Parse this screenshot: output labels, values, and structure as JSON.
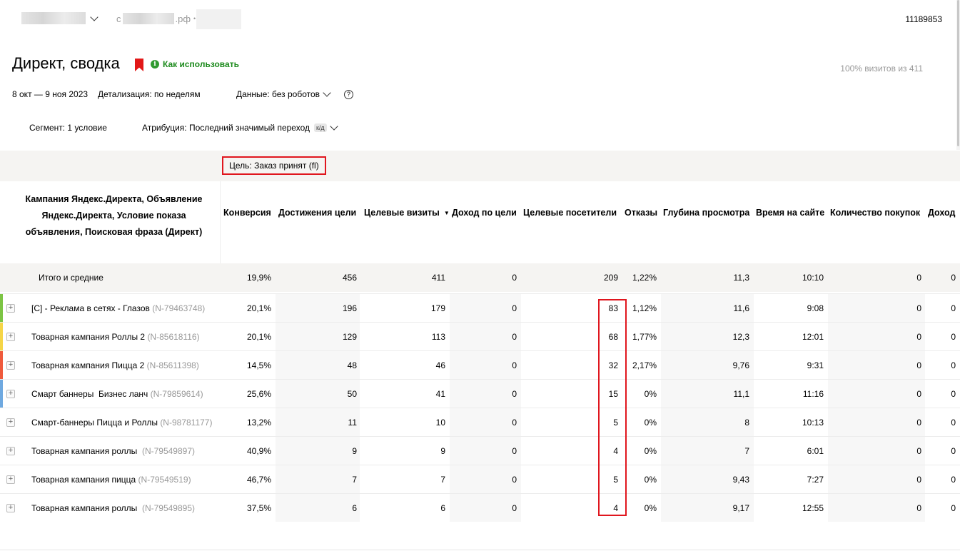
{
  "topbar": {
    "domain_suffix": ".рф",
    "domain_prefix": "с",
    "separator": "•",
    "counter_id": "11189853"
  },
  "header": {
    "title": "Директ, сводка",
    "how_to_use": "Как использовать",
    "info_icon": "i",
    "visits_share": "100% визитов из 411"
  },
  "filters": {
    "date_range": "8 окт — 9 ноя 2023",
    "detail": "Детализация: по неделям",
    "data": "Данные: без роботов",
    "help": "?",
    "segment": "Сегмент: 1 условие",
    "attribution": "Атрибуция: Последний значимый переход",
    "attribution_badge": "к/д"
  },
  "table": {
    "goal": "Цель: Заказ принят (fl)",
    "dimension_header": "Кампания Яндекс.Директа, Объявление Яндекс.Директа, Условие показа объявления, Поисковая фраза (Директ)",
    "columns": [
      "Конверсия",
      "Достижения цели",
      "Целевые визиты",
      "Доход по цели",
      "Целевые посетители",
      "Отказы",
      "Глубина просмотра",
      "Время на сайте",
      "Количество покупок",
      "Доход"
    ],
    "sort_icon": "▼",
    "expand_icon": "+",
    "totals": {
      "label": "Итого и средние",
      "values": [
        "19,9%",
        "456",
        "411",
        "0",
        "209",
        "1,22%",
        "11,3",
        "10:10",
        "0",
        "0"
      ]
    },
    "rows": [
      {
        "name": "[С] - Реклама в сетях - Глазов",
        "id": "(N-79463748)",
        "color": "#7cc444",
        "values": [
          "20,1%",
          "196",
          "179",
          "0",
          "83",
          "1,12%",
          "11,6",
          "9:08",
          "0",
          "0"
        ]
      },
      {
        "name": "Товарная кампания Роллы 2",
        "id": "(N-85618116)",
        "color": "#f5d547",
        "values": [
          "20,1%",
          "129",
          "113",
          "0",
          "68",
          "1,77%",
          "12,3",
          "12:01",
          "0",
          "0"
        ]
      },
      {
        "name": "Товарная кампания Пицца 2",
        "id": "(N-85611398)",
        "color": "#ef5a3c",
        "values": [
          "14,5%",
          "48",
          "46",
          "0",
          "32",
          "2,17%",
          "9,76",
          "9:31",
          "0",
          "0"
        ]
      },
      {
        "name": "Смарт баннеры  Бизнес ланч",
        "id": "(N-79859614)",
        "color": "#6fa9e0",
        "values": [
          "25,6%",
          "50",
          "41",
          "0",
          "15",
          "0%",
          "11,1",
          "11:16",
          "0",
          "0"
        ]
      },
      {
        "name": "Смарт-баннеры Пицца и Роллы",
        "id": "(N-98781177)",
        "color": "",
        "values": [
          "13,2%",
          "11",
          "10",
          "0",
          "5",
          "0%",
          "8",
          "10:13",
          "0",
          "0"
        ]
      },
      {
        "name": "Товарная кампания роллы ",
        "id": "(N-79549897)",
        "color": "",
        "values": [
          "40,9%",
          "9",
          "9",
          "0",
          "4",
          "0%",
          "7",
          "6:01",
          "0",
          "0"
        ]
      },
      {
        "name": "Товарная кампания пицца",
        "id": "(N-79549519)",
        "color": "",
        "values": [
          "46,7%",
          "7",
          "7",
          "0",
          "5",
          "0%",
          "9,43",
          "7:27",
          "0",
          "0"
        ]
      },
      {
        "name": "Товарная кампания роллы ",
        "id": "(N-79549895)",
        "color": "",
        "values": [
          "37,5%",
          "6",
          "6",
          "0",
          "4",
          "0%",
          "9,17",
          "12:55",
          "0",
          "0"
        ]
      }
    ]
  }
}
